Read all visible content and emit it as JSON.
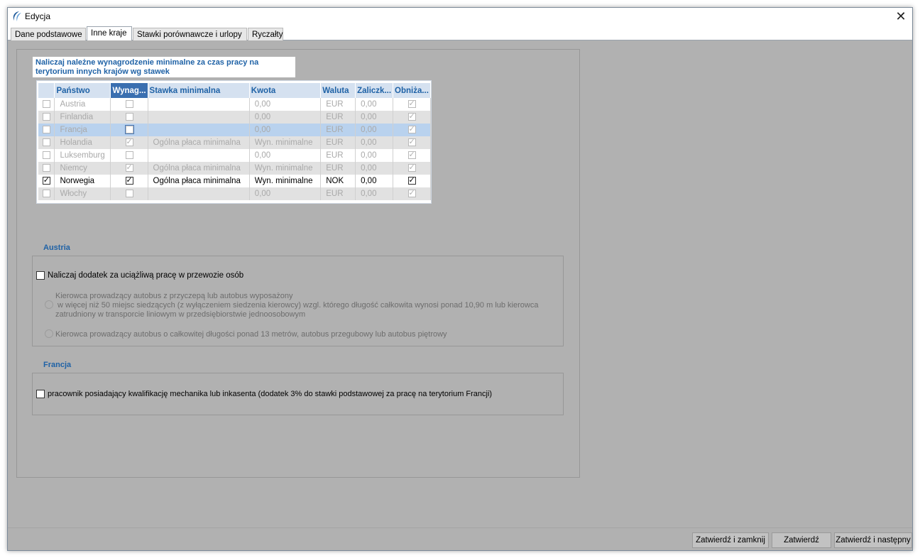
{
  "window": {
    "title": "Edycja",
    "close_glyph": "✕"
  },
  "tabs": [
    {
      "label": "Dane podstawowe"
    },
    {
      "label": "Inne kraje"
    },
    {
      "label": "Stawki porównawcze i urlopy"
    },
    {
      "label": "Ryczałty"
    }
  ],
  "countries_section": {
    "header": "Naliczaj należne wynagrodzenie minimalne za czas pracy na terytorium innych krajów wg stawek",
    "columns": [
      "",
      "Państwo",
      "Wynag...",
      "Stawka minimalna",
      "Kwota",
      "Waluta",
      "Zaliczk...",
      "Obniża..."
    ],
    "rows": [
      {
        "checked": false,
        "country": "Austria",
        "wynag": false,
        "stawka": "",
        "kwota": "0,00",
        "waluta": "EUR",
        "zaliczka": "0,00",
        "obniza": true
      },
      {
        "checked": false,
        "country": "Finlandia",
        "wynag": false,
        "stawka": "",
        "kwota": "0,00",
        "waluta": "EUR",
        "zaliczka": "0,00",
        "obniza": true
      },
      {
        "checked": false,
        "country": "Francja",
        "wynag": false,
        "stawka": "",
        "kwota": "0,00",
        "waluta": "EUR",
        "zaliczka": "0,00",
        "obniza": true
      },
      {
        "checked": false,
        "country": "Holandia",
        "wynag": true,
        "stawka": "Ogólna płaca minimalna",
        "kwota": "Wyn. minimalne",
        "waluta": "EUR",
        "zaliczka": "0,00",
        "obniza": true
      },
      {
        "checked": false,
        "country": "Luksemburg",
        "wynag": false,
        "stawka": "",
        "kwota": "0,00",
        "waluta": "EUR",
        "zaliczka": "0,00",
        "obniza": true
      },
      {
        "checked": false,
        "country": "Niemcy",
        "wynag": true,
        "stawka": "Ogólna płaca minimalna",
        "kwota": "Wyn. minimalne",
        "waluta": "EUR",
        "zaliczka": "0,00",
        "obniza": true
      },
      {
        "checked": true,
        "country": "Norwegia",
        "wynag": true,
        "stawka": "Ogólna płaca minimalna",
        "kwota": "Wyn. minimalne",
        "waluta": "NOK",
        "zaliczka": "0,00",
        "obniza": true
      },
      {
        "checked": false,
        "country": "Włochy",
        "wynag": false,
        "stawka": "",
        "kwota": "0,00",
        "waluta": "EUR",
        "zaliczka": "0,00",
        "obniza": true
      }
    ]
  },
  "austria": {
    "title": "Austria",
    "checkbox_label": "Naliczaj dodatek za uciążliwą pracę w przewozie osób",
    "radio1_lines": [
      "Kierowca prowadzący autobus z przyczepą lub autobus wyposażony",
      " w więcej niż 50 miejsc siedzących (z wyłączeniem siedzenia kierowcy) wzgl. którego długość całkowita wynosi ponad 10,90 m lub kierowca",
      "zatrudniony w transporcie liniowym w przedsiębiorstwie jednoosobowym"
    ],
    "radio2_label": "Kierowca prowadzący autobus o całkowitej długości ponad 13 metrów, autobus przegubowy lub autobus piętrowy"
  },
  "francja": {
    "title": "Francja",
    "checkbox_label": "pracownik posiadający kwalifikację mechanika lub inkasenta (dodatek 3% do stawki podstawowej za pracę na terytorium Francji)"
  },
  "footer": {
    "confirm_close": "Zatwierdź i zamknij",
    "confirm": "Zatwierdź",
    "confirm_next": "Zatwierdź i następny"
  },
  "colors": {
    "accent": "#1f62a6",
    "background": "#b1b1b1",
    "highlight_row": "#b9d2ee"
  },
  "icons": [
    "app-logo-icon",
    "close-icon",
    "checkbox-icon",
    "radio-icon"
  ]
}
